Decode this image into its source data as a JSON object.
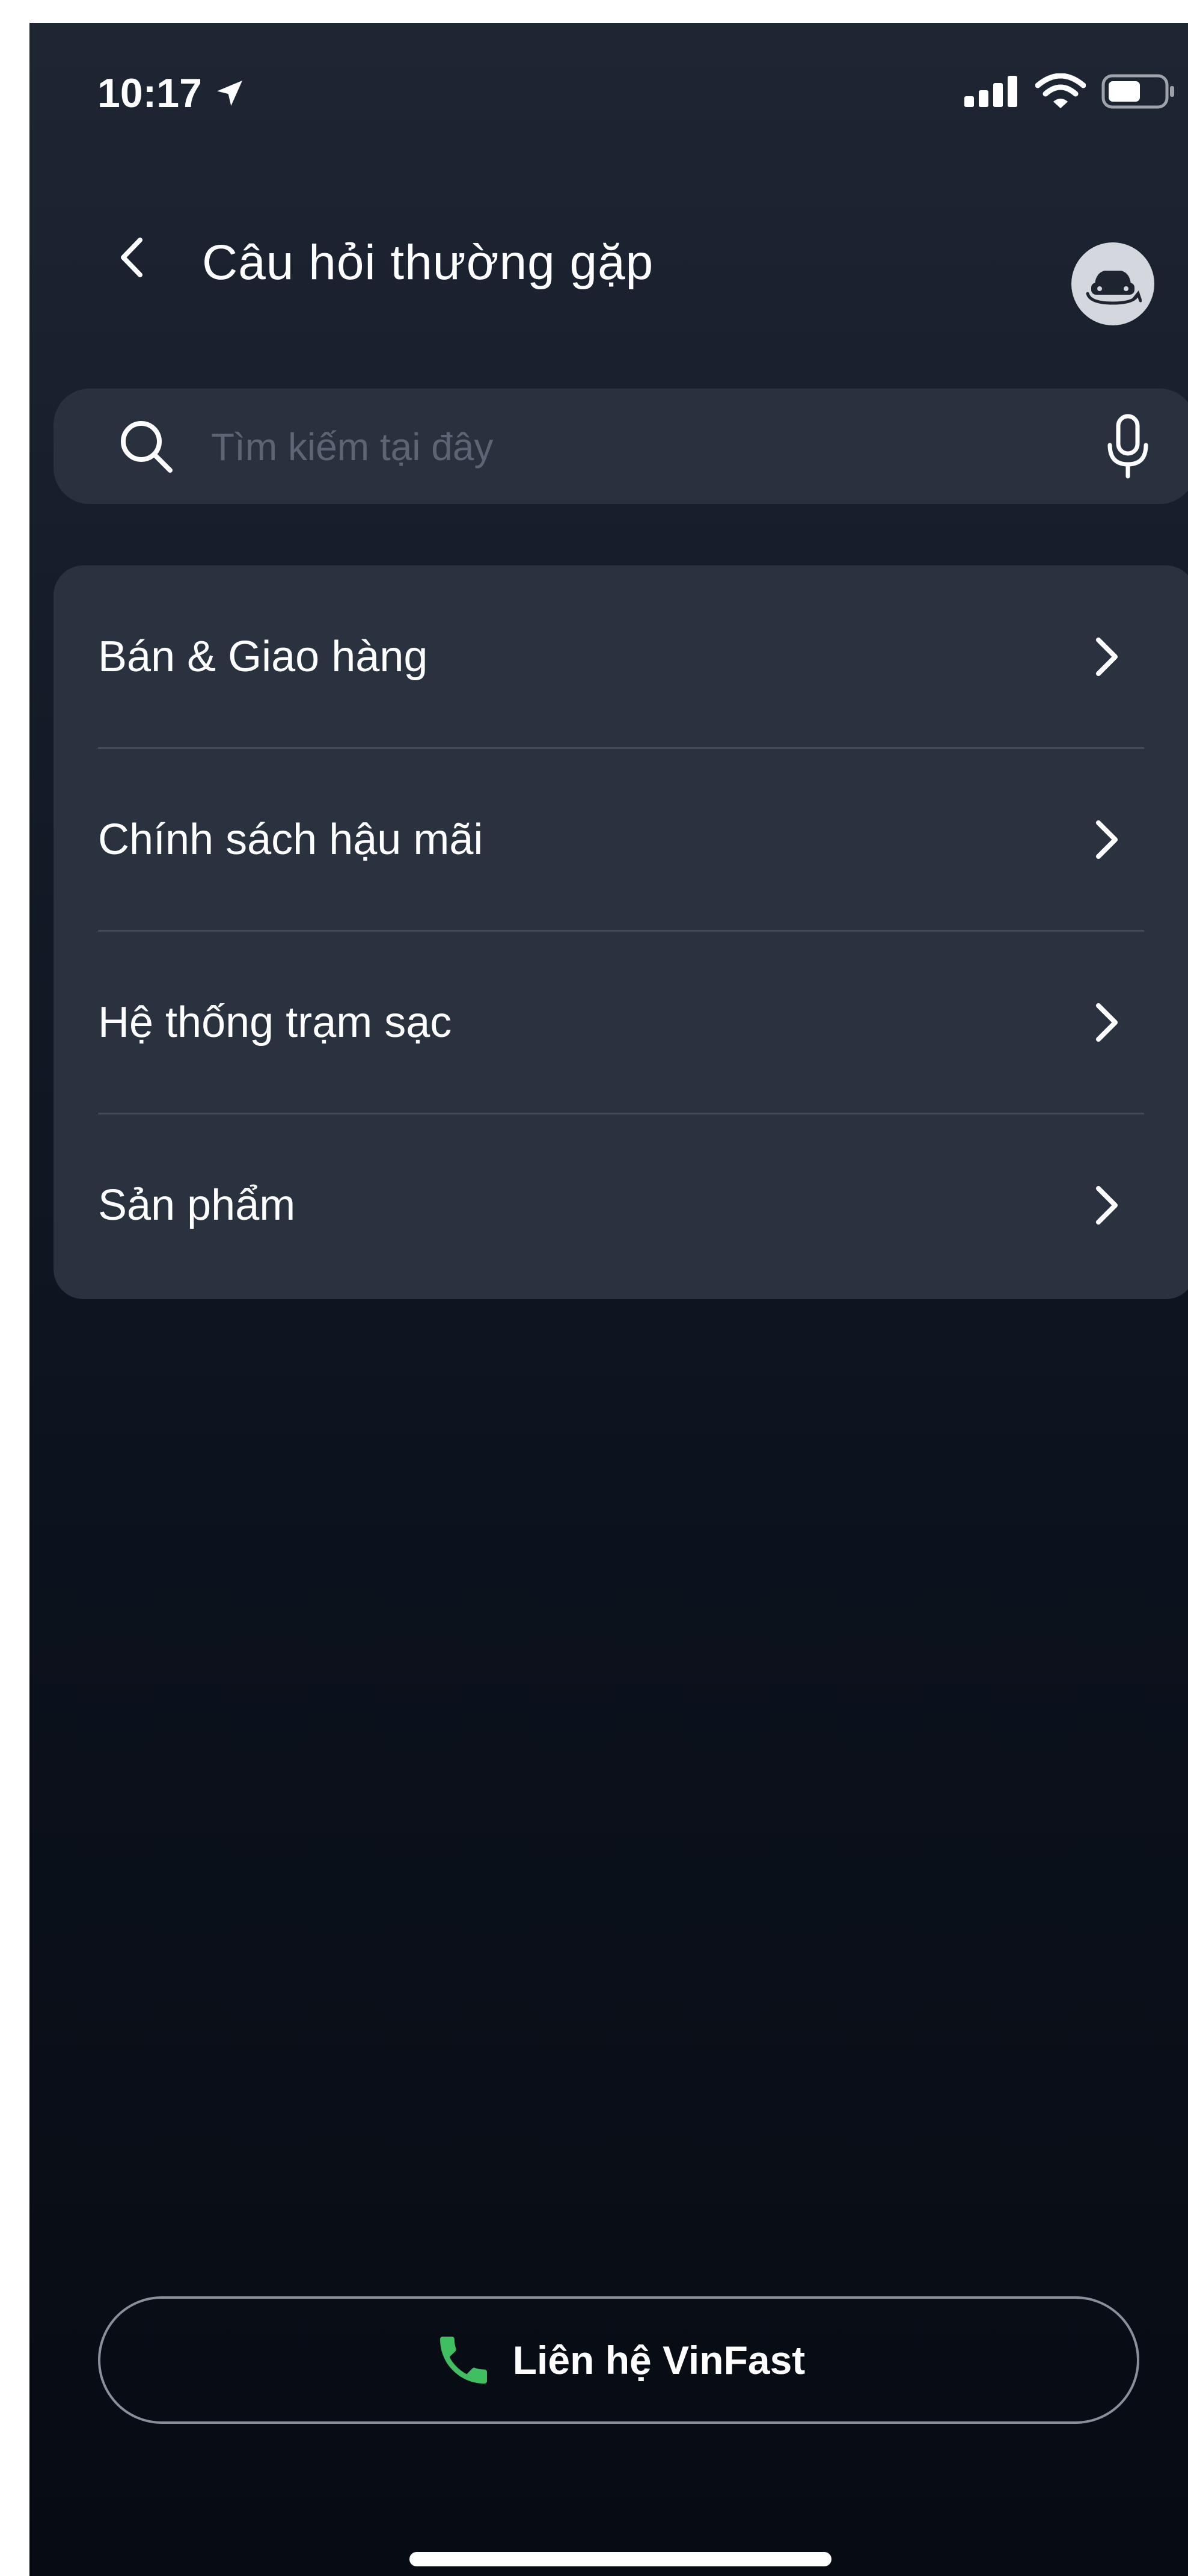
{
  "status_bar": {
    "time": "10:17",
    "icons": [
      "location-arrow-icon",
      "signal-icon",
      "wifi-icon",
      "battery-icon"
    ]
  },
  "header": {
    "title": "Câu hỏi thường gặp",
    "back_icon": "chevron-left-icon",
    "car_icon": "car-switch-icon"
  },
  "search": {
    "placeholder": "Tìm kiếm tại đây",
    "value": "",
    "icon": "search-icon",
    "mic_icon": "microphone-icon"
  },
  "categories": {
    "items": [
      {
        "label": "Bán & Giao hàng"
      },
      {
        "label": "Chính sách hậu mãi"
      },
      {
        "label": "Hệ thống trạm sạc"
      },
      {
        "label": "Sản phẩm"
      }
    ]
  },
  "contact": {
    "label": "Liên hệ VinFast",
    "icon": "phone-icon",
    "icon_color": "#3fbf5f"
  }
}
